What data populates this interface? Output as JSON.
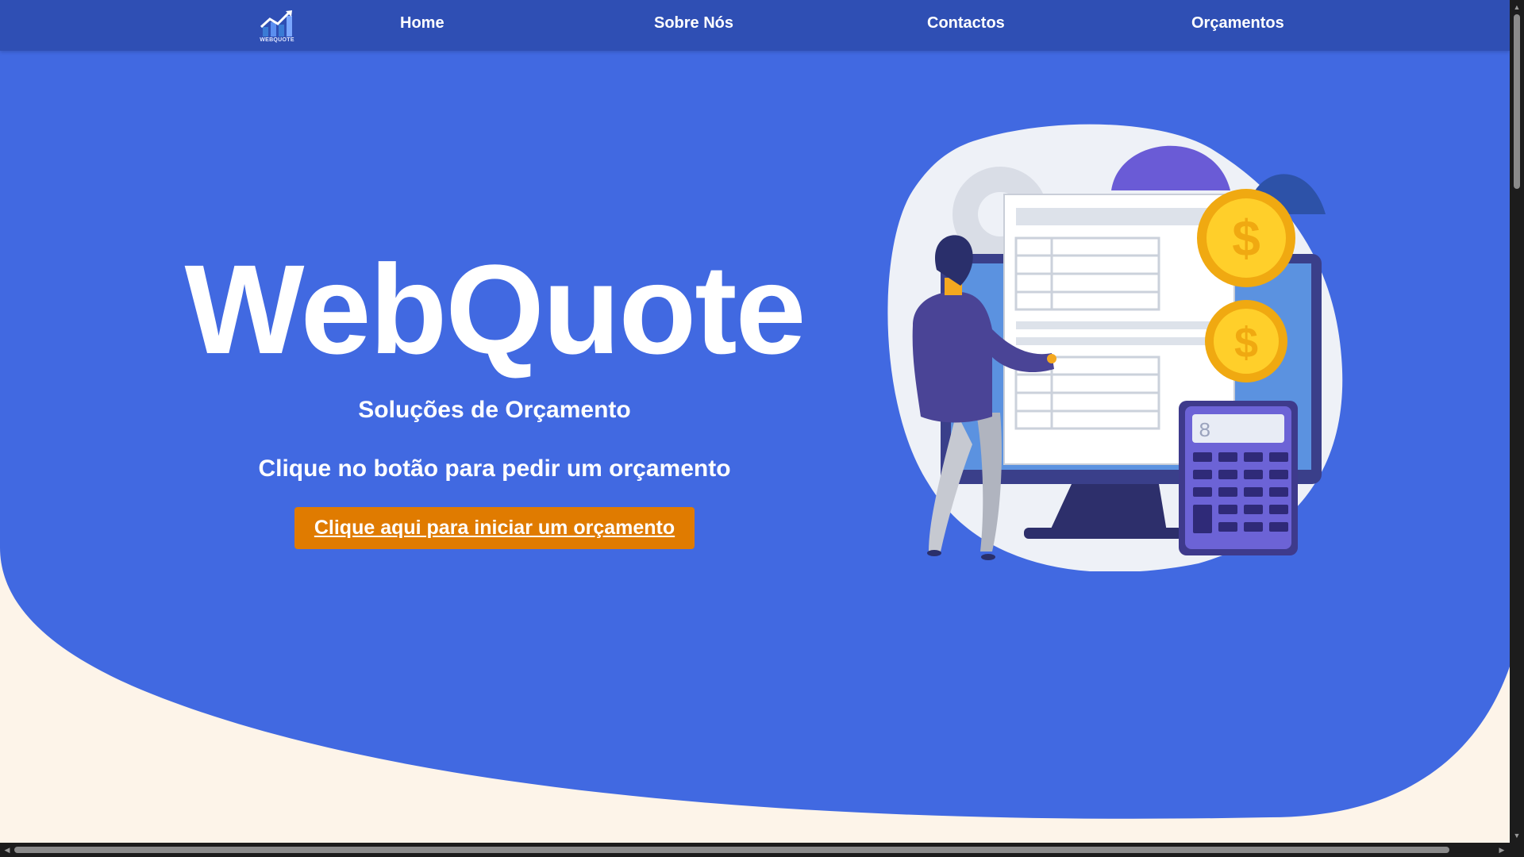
{
  "colors": {
    "hero_blue": "#4169e1",
    "nav_blue": "#2f4fb4",
    "cream": "#fdf4e9",
    "cta_orange": "#e07b00"
  },
  "nav": {
    "logo_icon": "rising-chart-logo",
    "logo_text": "WEBQUOTE",
    "items": [
      {
        "label": "Home"
      },
      {
        "label": "Sobre Nós"
      },
      {
        "label": "Contactos"
      },
      {
        "label": "Orçamentos"
      }
    ]
  },
  "hero": {
    "title": "WebQuote",
    "subtitle": "Soluções de Orçamento",
    "text": "Clique no botão para pedir um orçamento",
    "cta_label": "Clique aqui para iniciar um orçamento",
    "illustration": {
      "icon": "budget-illustration",
      "coins_symbol": "$",
      "calculator_display": "8"
    }
  },
  "scrollbars": {
    "up_icon": "▲",
    "down_icon": "▼",
    "left_icon": "◀",
    "right_icon": "▶"
  }
}
